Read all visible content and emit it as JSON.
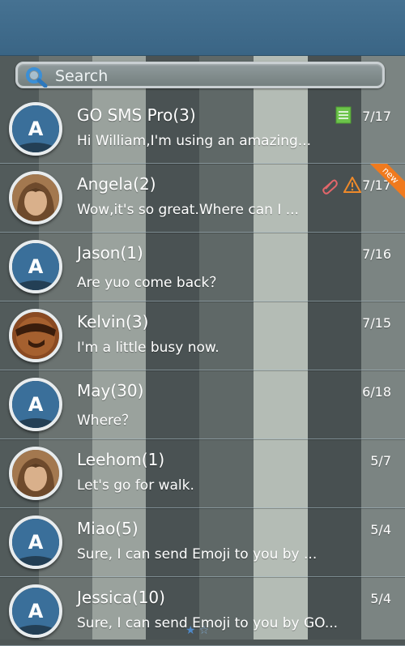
{
  "search": {
    "placeholder": "Search"
  },
  "conversations": [
    {
      "name": "GO SMS Pro(3)",
      "snippet": "Hi William,I'm using an amazing...",
      "date": "7/17",
      "avatar": "default-a-avatar",
      "indicators": [
        "document-icon"
      ]
    },
    {
      "name": "Angela(2)",
      "snippet": "Wow,it's so great.Where can I ...",
      "date": "7/17",
      "avatar": "girl-avatar",
      "indicators": [
        "paperclip-icon",
        "warning-icon"
      ],
      "badge": "new"
    },
    {
      "name": "Jason(1)",
      "snippet": "Are yuo come back？",
      "date": "7/16",
      "avatar": "default-a-avatar"
    },
    {
      "name": "Kelvin(3)",
      "snippet": "I'm a little busy now.",
      "date": "7/15",
      "avatar": "pirate-avatar"
    },
    {
      "name": "May(30)",
      "snippet": "Where？",
      "date": "6/18",
      "avatar": "default-a-avatar"
    },
    {
      "name": "Leehom(1)",
      "snippet": "Let's go for walk.",
      "date": "5/7",
      "avatar": "girl-avatar"
    },
    {
      "name": "Miao(5)",
      "snippet": "Sure, I can send Emoji to you by ...",
      "date": "5/4",
      "avatar": "default-a-avatar"
    },
    {
      "name": "Jessica(10)",
      "snippet": "Sure, I can send Emoji to you by GO...",
      "date": "5/4",
      "avatar": "default-a-avatar"
    }
  ],
  "colors": {
    "header": "#3f6a89",
    "new_badge": "#f07a1e",
    "doc_icon": "#6cc44a",
    "warning_icon": "#ef8a2a",
    "stripe_light": "#b3bcb6",
    "stripe_dark": "#4b5354"
  }
}
